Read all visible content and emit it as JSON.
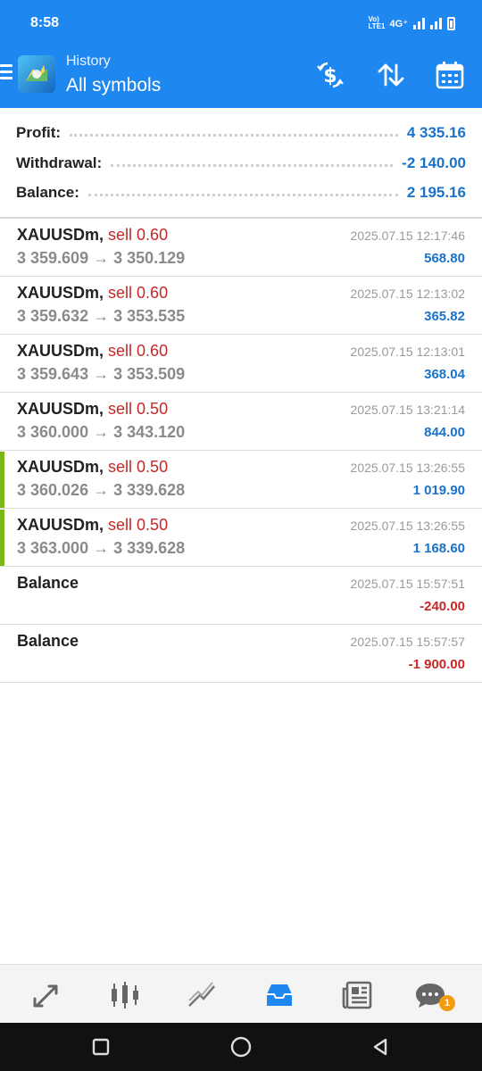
{
  "status_bar": {
    "time": "8:58",
    "network": "4G⁺",
    "volte": "Vo) LTE1"
  },
  "toolbar": {
    "subtitle": "History",
    "title": "All symbols"
  },
  "summary": {
    "profit_label": "Profit:",
    "profit_value": "4 335.16",
    "withdrawal_label": "Withdrawal:",
    "withdrawal_value": "-2 140.00",
    "balance_label": "Balance:",
    "balance_value": "2 195.16"
  },
  "deals": [
    {
      "symbol": "XAUUSDm,",
      "action": "sell 0.60",
      "prices": "3 359.609 → 3 350.129",
      "time": "2025.07.15 12:17:46",
      "profit": "568.80"
    },
    {
      "symbol": "XAUUSDm,",
      "action": "sell 0.60",
      "prices": "3 359.632 → 3 353.535",
      "time": "2025.07.15 12:13:02",
      "profit": "365.82"
    },
    {
      "symbol": "XAUUSDm,",
      "action": "sell 0.60",
      "prices": "3 359.643 → 3 353.509",
      "time": "2025.07.15 12:13:01",
      "profit": "368.04"
    },
    {
      "symbol": "XAUUSDm,",
      "action": "sell 0.50",
      "prices": "3 360.000 → 3 343.120",
      "time": "2025.07.15 13:21:14",
      "profit": "844.00"
    },
    {
      "symbol": "XAUUSDm,",
      "action": "sell 0.50",
      "prices": "3 360.026 → 3 339.628",
      "time": "2025.07.15 13:26:55",
      "profit": "1 019.90"
    },
    {
      "symbol": "XAUUSDm,",
      "action": "sell 0.50",
      "prices": "3 363.000 → 3 339.628",
      "time": "2025.07.15 13:26:55",
      "profit": "1 168.60"
    }
  ],
  "balance_ops": [
    {
      "label": "Balance",
      "time": "2025.07.15 15:57:51",
      "amount": "-240.00"
    },
    {
      "label": "Balance",
      "time": "2025.07.15 15:57:57",
      "amount": "-1 900.00"
    }
  ],
  "bottom_nav": {
    "chat_badge": "1"
  },
  "icons": [
    "menu-icon",
    "app-logo-icon",
    "deposit-withdraw-icon",
    "sort-icon",
    "calendar-icon",
    "quotes-icon",
    "chart-icon",
    "trade-icon",
    "history-icon",
    "news-icon",
    "chat-icon"
  ],
  "colors": {
    "header": "#1e88f0",
    "profit_positive": "#1a73c9",
    "negative": "#c62828",
    "sell": "#c62828",
    "marker": "#7cb518",
    "nav_active": "#1e88f0"
  }
}
